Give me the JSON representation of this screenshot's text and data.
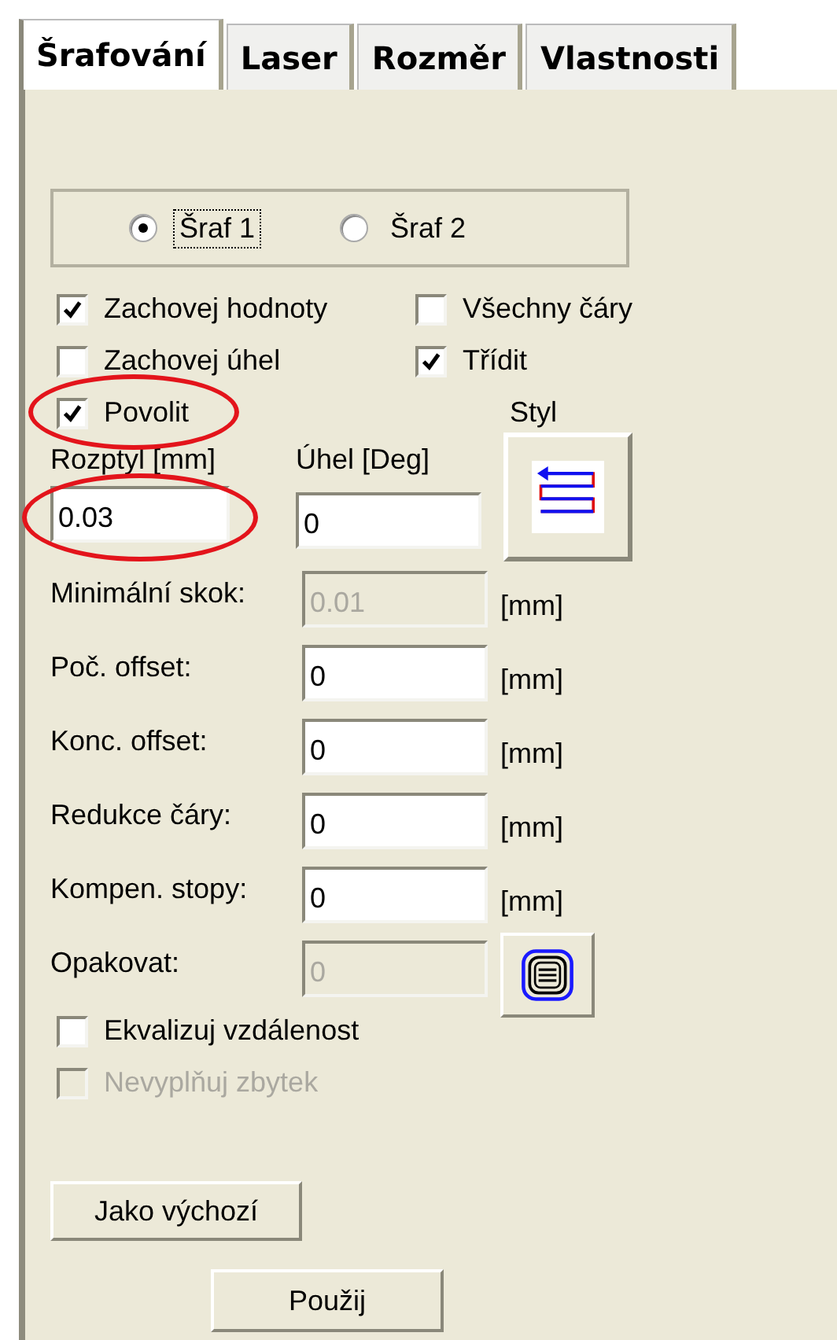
{
  "tabs": [
    {
      "label": "Šrafování",
      "selected": true
    },
    {
      "label": "Laser",
      "selected": false
    },
    {
      "label": "Rozměr",
      "selected": false
    },
    {
      "label": "Vlastnosti",
      "selected": false
    }
  ],
  "hatch_options": [
    {
      "label": "Šraf 1",
      "selected": true,
      "focused": true
    },
    {
      "label": "Šraf 2",
      "selected": false,
      "focused": false
    }
  ],
  "checkboxes": [
    {
      "label": "Zachovej hodnoty",
      "checked": true,
      "highlighted": false
    },
    {
      "label": "Všechny čáry",
      "checked": false,
      "highlighted": false
    },
    {
      "label": "Zachovej úhel",
      "checked": false,
      "highlighted": false
    },
    {
      "label": "Třídit",
      "checked": true,
      "highlighted": false
    },
    {
      "label": "Povolit",
      "checked": true,
      "highlighted": true
    }
  ],
  "style_label": "Styl",
  "spacing": {
    "label": "Rozptyl [mm]",
    "value": "0.03",
    "highlighted": true
  },
  "angle": {
    "label": "Úhel [Deg]",
    "value": "0"
  },
  "fields": [
    {
      "label": "Minimální skok:",
      "value": "0.01",
      "unit": "[mm]",
      "disabled": true
    },
    {
      "label": "Poč. offset:",
      "value": "0",
      "unit": "[mm]",
      "disabled": false
    },
    {
      "label": "Konc. offset:",
      "value": "0",
      "unit": "[mm]",
      "disabled": false
    },
    {
      "label": "Redukce čáry:",
      "value": "0",
      "unit": "[mm]",
      "disabled": false
    },
    {
      "label": "Kompen. stopy:",
      "value": "0",
      "unit": "[mm]",
      "disabled": false
    },
    {
      "label": "Opakovat:",
      "value": "0",
      "disabled": true
    }
  ],
  "bottom_checkboxes": [
    {
      "label": "Ekvalizuj vzdálenost",
      "checked": false,
      "disabled": false
    },
    {
      "label": "Nevyplňuj zbytek",
      "checked": false,
      "disabled": true
    }
  ],
  "buttons": [
    "Jako výchozí",
    "Použij"
  ]
}
